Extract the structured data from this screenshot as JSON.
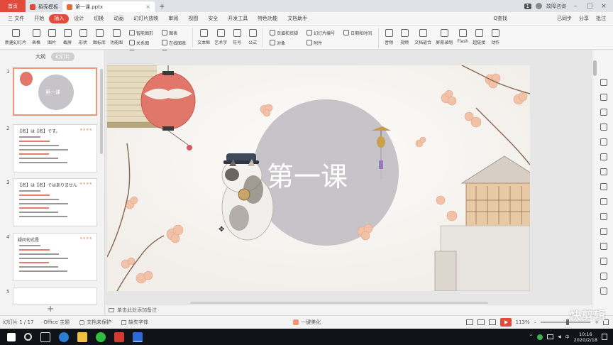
{
  "tabbar": {
    "home_label": "首页",
    "template_tab": "稻壳模板",
    "doc_tab": "第一课.pptx",
    "page_badge": "1",
    "user_label": "故障咨询"
  },
  "menubar": {
    "file_label": "三 文件",
    "items": [
      "开始",
      "插入",
      "设计",
      "切换",
      "动画",
      "幻灯片放映",
      "审阅",
      "视图",
      "安全",
      "开发工具",
      "特色功能",
      "文档助手"
    ],
    "active_index": 1,
    "search_label": "Q查找",
    "sync_label": "已同步",
    "share_label": "分享",
    "comment_label": "批注"
  },
  "ribbon": {
    "buttons": [
      {
        "label": "新建幻灯片",
        "icon": "new-slide-icon"
      },
      {
        "label": "表格",
        "icon": "table-icon"
      },
      {
        "label": "图片",
        "icon": "picture-icon"
      },
      {
        "label": "截屏",
        "icon": "screenshot-icon"
      },
      {
        "label": "形状",
        "icon": "shape-icon"
      },
      {
        "label": "图标库",
        "icon": "icon-library-icon"
      },
      {
        "label": "功能图",
        "icon": "function-chart-icon"
      }
    ],
    "small_buttons": [
      "智能图形",
      "图表",
      "关系图",
      "在线图表",
      "稻壳资源",
      "流程图"
    ],
    "buttons2": [
      {
        "label": "文本框",
        "icon": "textbox-icon"
      },
      {
        "label": "艺术字",
        "icon": "wordart-icon"
      },
      {
        "label": "符号",
        "icon": "symbol-icon"
      },
      {
        "label": "公式",
        "icon": "formula-icon"
      }
    ],
    "small_buttons2": [
      "页眉和页脚",
      "幻灯片编号",
      "日期和时间",
      "对象",
      "附件"
    ],
    "buttons3": [
      {
        "label": "音频",
        "icon": "audio-icon"
      },
      {
        "label": "视频",
        "icon": "video-icon"
      },
      {
        "label": "文档嵌合",
        "icon": "doc-embed-icon"
      },
      {
        "label": "屏幕录制",
        "icon": "screen-record-icon"
      },
      {
        "label": "Flash",
        "icon": "flash-icon"
      },
      {
        "label": "超链接",
        "icon": "hyperlink-icon"
      },
      {
        "label": "动作",
        "icon": "action-icon"
      }
    ]
  },
  "leftpanel": {
    "tab_outline": "大纲",
    "tab_slides": "幻灯片",
    "thumbs": [
      {
        "num": "1",
        "title": "第一课"
      },
      {
        "num": "2",
        "title": "【名】は【名】です。",
        "stars": "★★★★"
      },
      {
        "num": "3",
        "title": "【名】は【名】ではありません",
        "stars": "★★★★"
      },
      {
        "num": "4",
        "title": "疑问句式是",
        "stars": "★★★★"
      },
      {
        "num": "5",
        "title": ""
      }
    ]
  },
  "slide": {
    "title": "第一课"
  },
  "notes": {
    "placeholder": "单击此处添加备注"
  },
  "statusbar": {
    "slide_count": "幻灯片 1 / 17",
    "theme": "Office 主题",
    "doc_protect": "文档未保护",
    "font_missing": "缺失字体",
    "beautify": "一键美化",
    "zoom": "113%",
    "zoom_fraction": 0.55
  },
  "taskbar": {
    "time": "10:16",
    "date": "2020/2/18"
  },
  "colors": {
    "accent": "#e24a3b",
    "circle": "#c6c4c8"
  },
  "watermark": "快剪辑"
}
